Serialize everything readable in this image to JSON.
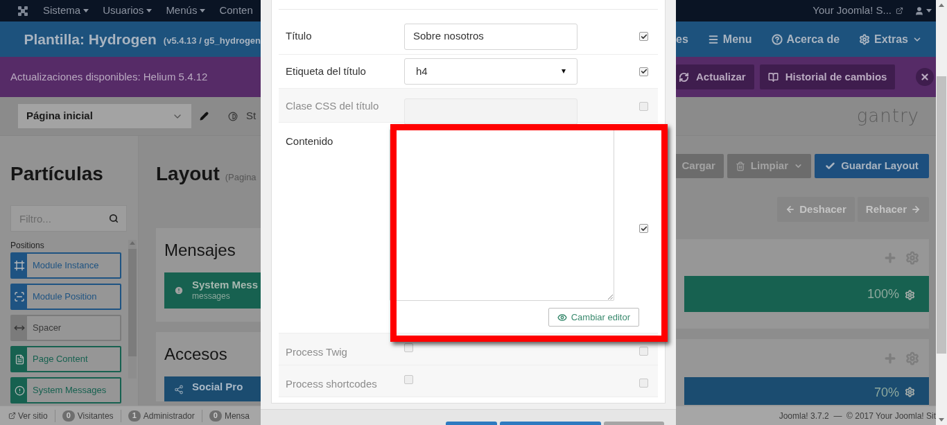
{
  "top_nav": {
    "menu": [
      {
        "label": "Sistema"
      },
      {
        "label": "Usuarios"
      },
      {
        "label": "Menús"
      },
      {
        "label": "Conten"
      }
    ],
    "site_link": "Your Joomla! S..."
  },
  "header": {
    "title": "Plantilla: Hydrogen",
    "version": "(v5.4.13 / g5_hydrogen",
    "menu": [
      {
        "label": "es",
        "kind": "plain"
      },
      {
        "label": "Menu",
        "kind": "menu"
      },
      {
        "label": "Acerca de",
        "kind": "help"
      },
      {
        "label": "Extras",
        "kind": "extras"
      }
    ]
  },
  "update_bar": {
    "message": "Actualizaciones disponibles: Helium 5.4.12",
    "buttons": [
      {
        "label": "Actualizar",
        "kind": "refresh"
      },
      {
        "label": "Historial de cambios",
        "kind": "book"
      }
    ]
  },
  "toolbar": {
    "page_select": "Página inicial",
    "style_tab": "St",
    "logo": "gantry"
  },
  "particles": {
    "title": "Partículas",
    "filter_placeholder": "Filtro...",
    "group": "Positions",
    "items": [
      {
        "label": "Module Instance",
        "kind": "instance",
        "color": "#1e5382"
      },
      {
        "label": "Module Position",
        "kind": "position",
        "color": "#1e5382"
      },
      {
        "label": "Spacer",
        "kind": "spacer",
        "color": "#7b7b7b"
      },
      {
        "label": "Page Content",
        "kind": "content",
        "color": "#176150"
      },
      {
        "label": "System Messages",
        "kind": "messages",
        "color": "#176150"
      }
    ]
  },
  "layout": {
    "title": "Layout",
    "subtitle": "(Pagina",
    "actions": [
      {
        "label": "Cargar",
        "kind": "load"
      },
      {
        "label": "Limpiar",
        "kind": "clear"
      },
      {
        "label": "Guardar Layout",
        "kind": "save"
      }
    ],
    "history": [
      {
        "label": "Deshacer",
        "kind": "undo",
        "disabled": true
      },
      {
        "label": "Rehacer",
        "kind": "redo",
        "disabled": true
      }
    ],
    "sections": [
      {
        "title": "Mensajes",
        "block": {
          "name": "System Mess",
          "sub": "messages",
          "size": "100%",
          "kind": "messages",
          "color": "#176150"
        }
      },
      {
        "title": "Accesos",
        "block": {
          "name": "Social Pro",
          "size": "70%",
          "kind": "share",
          "color": "#1b4c70"
        }
      }
    ]
  },
  "modal": {
    "fields": [
      {
        "label": "Título",
        "kind": "text",
        "value": "Sobre nosotros",
        "disabled": false,
        "checked": true
      },
      {
        "label": "Etiqueta del título",
        "kind": "select",
        "value": "h4",
        "disabled": false,
        "checked": true
      },
      {
        "label": "Clase CSS del título",
        "kind": "text",
        "disabled": true,
        "checked": false
      },
      {
        "label": "Contenido",
        "kind": "textarea",
        "button": "Cambiar editor",
        "highlighted": true,
        "disabled": false,
        "checked": true
      },
      {
        "label": "Process Twig",
        "kind": "checkbox",
        "value_checked": false,
        "disabled": true,
        "checked": false
      },
      {
        "label": "Process shortcodes",
        "kind": "checkbox",
        "value_checked": false,
        "disabled": true,
        "checked": false
      }
    ]
  },
  "status_bar": {
    "view_site": "Ver sitio",
    "counters": [
      {
        "count": "0",
        "label": "Visitantes"
      },
      {
        "count": "1",
        "label": "Administrador"
      },
      {
        "count": "0",
        "label": "Mensa"
      }
    ],
    "copyright": "Joomla! 3.7.2  —  © 2017 Your Joomla! Sit"
  }
}
